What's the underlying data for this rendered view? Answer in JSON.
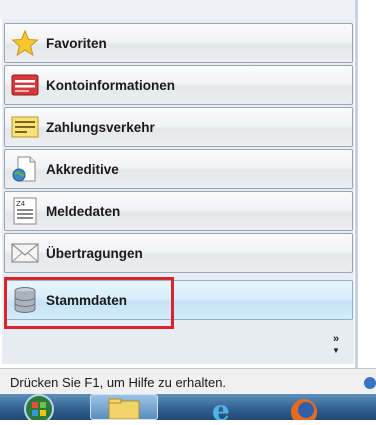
{
  "nav": {
    "items": [
      {
        "label": "Favoriten",
        "icon": "star-icon",
        "active": false
      },
      {
        "label": "Kontoinformationen",
        "icon": "account-info-icon",
        "active": false
      },
      {
        "label": "Zahlungsverkehr",
        "icon": "payment-icon",
        "active": false
      },
      {
        "label": "Akkreditive",
        "icon": "letter-of-credit-icon",
        "active": false
      },
      {
        "label": "Meldedaten",
        "icon": "report-data-icon",
        "active": false
      },
      {
        "label": "Übertragungen",
        "icon": "envelope-icon",
        "active": false
      },
      {
        "label": "Stammdaten",
        "icon": "database-icon",
        "active": true
      }
    ],
    "more_glyph": "»"
  },
  "status_bar": {
    "text": "Drücken Sie F1, um Hilfe zu erhalten."
  },
  "taskbar": {
    "items": [
      "start-orb-icon",
      "explorer-icon",
      "internet-explorer-icon",
      "firefox-icon"
    ]
  },
  "colors": {
    "highlight_border": "#d9242a",
    "active_button": "#d9eefb",
    "taskbar": "#2f5d8c"
  }
}
